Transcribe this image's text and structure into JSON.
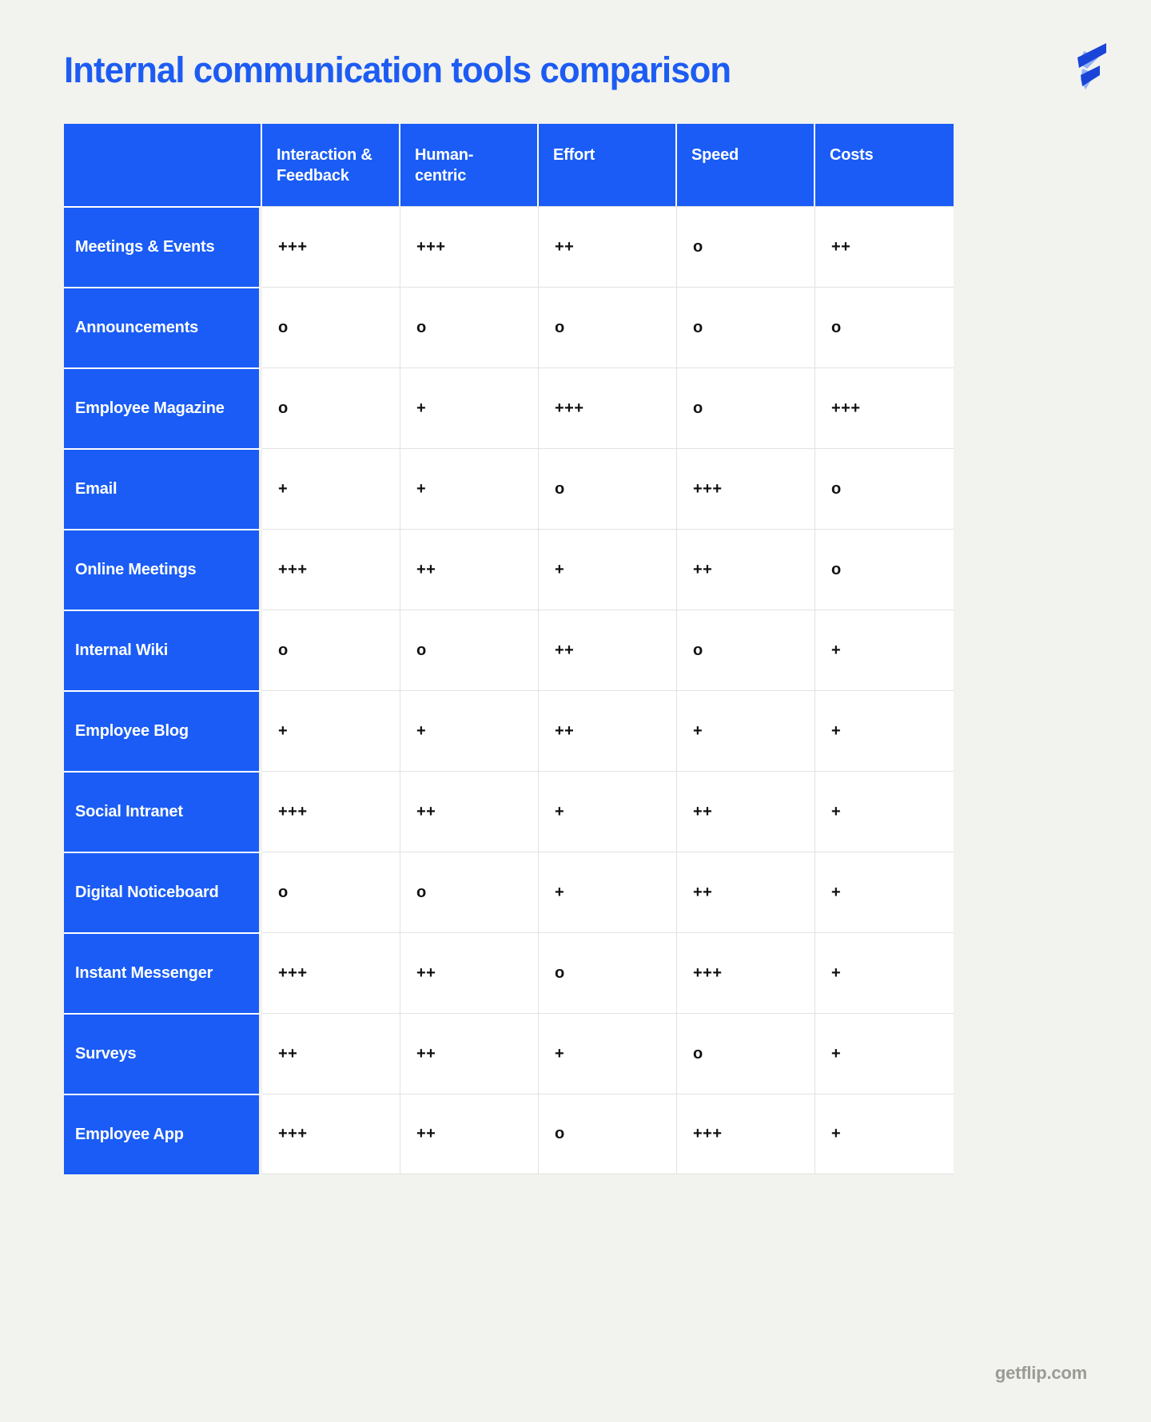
{
  "header": {
    "title": "Internal communication tools comparison",
    "logo_name": "flip-logo"
  },
  "footer": {
    "brand": "getflip.com"
  },
  "chart_data": {
    "type": "table",
    "title": "Internal communication tools comparison",
    "row_header_label": "",
    "categories": [
      "Interaction & Feedback",
      "Human-centric",
      "Effort",
      "Speed",
      "Costs"
    ],
    "legend": [
      "+++",
      "++",
      "+",
      "o"
    ],
    "rows": [
      {
        "label": "Meetings & Events",
        "values": [
          "+++",
          "+++",
          "++",
          "o",
          "++"
        ]
      },
      {
        "label": "Announcements",
        "values": [
          "o",
          "o",
          "o",
          "o",
          "o"
        ]
      },
      {
        "label": "Employee Magazine",
        "values": [
          "o",
          "+",
          "+++",
          "o",
          "+++"
        ]
      },
      {
        "label": "Email",
        "values": [
          "+",
          "+",
          "o",
          "+++",
          "o"
        ]
      },
      {
        "label": "Online Meetings",
        "values": [
          "+++",
          "++",
          "+",
          "++",
          "o"
        ]
      },
      {
        "label": "Internal Wiki",
        "values": [
          "o",
          "o",
          "++",
          "o",
          "+"
        ]
      },
      {
        "label": "Employee Blog",
        "values": [
          "+",
          "+",
          "++",
          "+",
          "+"
        ]
      },
      {
        "label": "Social Intranet",
        "values": [
          "+++",
          "++",
          "+",
          "++",
          "+"
        ]
      },
      {
        "label": "Digital Noticeboard",
        "values": [
          "o",
          "o",
          "+",
          "++",
          "+"
        ]
      },
      {
        "label": "Instant Messenger",
        "values": [
          "+++",
          "++",
          "o",
          "+++",
          "+"
        ]
      },
      {
        "label": "Surveys",
        "values": [
          "++",
          "++",
          "+",
          "o",
          "+"
        ]
      },
      {
        "label": "Employee App",
        "values": [
          "+++",
          "++",
          "o",
          "+++",
          "+"
        ]
      }
    ]
  },
  "colors": {
    "brand_blue": "#1a5cf5",
    "title_blue": "#1d5cf3",
    "page_background": "#f2f2ee",
    "cell_background": "#ffffff",
    "grid_line": "#e2e2e0",
    "value_text": "#111111",
    "footer_text": "#9b9b95"
  }
}
